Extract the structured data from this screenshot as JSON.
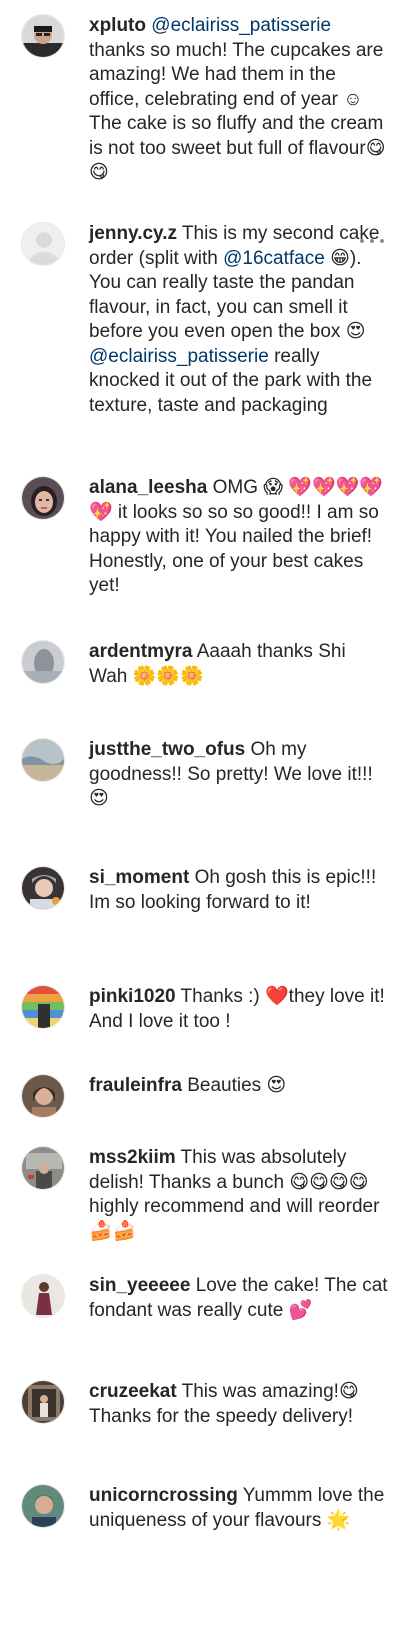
{
  "comments": [
    {
      "user": "xpluto",
      "parts": [
        {
          "type": "mention",
          "text": "@eclairiss_patisserie"
        },
        {
          "type": "text",
          "text": " thanks so much! The cupcakes are amazing! We had them in the office, celebrating end of year ☺ The cake is so fluffy and the cream is not too sweet but full of flavour😋😋"
        }
      ]
    },
    {
      "user": "jenny.cy.z",
      "parts": [
        {
          "type": "text",
          "text": " This is my second cake order (split with "
        },
        {
          "type": "mention",
          "text": "@16catface"
        },
        {
          "type": "text",
          "text": " 😁). You can really taste the pandan flavour, in fact, you can smell it before you even open the box 😍 "
        },
        {
          "type": "mention",
          "text": "@eclairiss_patisserie"
        },
        {
          "type": "text",
          "text": " really knocked it out of the park with the texture, taste and packaging"
        }
      ]
    },
    {
      "user": "alana_leesha",
      "parts": [
        {
          "type": "text",
          "text": " OMG 😱 💖💖💖💖💖 it looks so so so good!! I am so happy with it! You nailed the brief! Honestly, one of your best cakes yet!"
        }
      ]
    },
    {
      "user": "ardentmyra",
      "parts": [
        {
          "type": "text",
          "text": " Aaaah thanks Shi Wah 🌼🌼🌼"
        }
      ]
    },
    {
      "user": "justthe_two_ofus",
      "parts": [
        {
          "type": "text",
          "text": " Oh my goodness!! So pretty! We love it!!! 😍"
        }
      ]
    },
    {
      "user": "si_moment",
      "parts": [
        {
          "type": "text",
          "text": " Oh gosh this is epic!!! Im so looking forward to it!"
        }
      ]
    },
    {
      "user": "pinki1020",
      "parts": [
        {
          "type": "text",
          "text": " Thanks :) ❤️they love it! And I love it too !"
        }
      ]
    },
    {
      "user": "frauleinfra",
      "parts": [
        {
          "type": "text",
          "text": " Beauties 😍"
        }
      ]
    },
    {
      "user": "mss2kiim",
      "parts": [
        {
          "type": "text",
          "text": " This was absolutely delish! Thanks a bunch 😋😋😋😋 highly recommend and will reorder 🍰🍰"
        }
      ]
    },
    {
      "user": "sin_yeeeee",
      "parts": [
        {
          "type": "text",
          "text": " Love the cake! The cat fondant was really cute 💕"
        }
      ]
    },
    {
      "user": "cruzeekat",
      "parts": [
        {
          "type": "text",
          "text": " This was amazing!😋 Thanks for the speedy delivery!"
        }
      ]
    },
    {
      "user": "unicorncrossing",
      "parts": [
        {
          "type": "text",
          "text": " Yummm love the uniqueness of your flavours 🌟"
        }
      ]
    }
  ],
  "colors": {
    "text": "#262626",
    "mention": "#00376b",
    "muted": "#8e8e8e"
  },
  "icons": {
    "more_options": "ellipsis-icon"
  }
}
